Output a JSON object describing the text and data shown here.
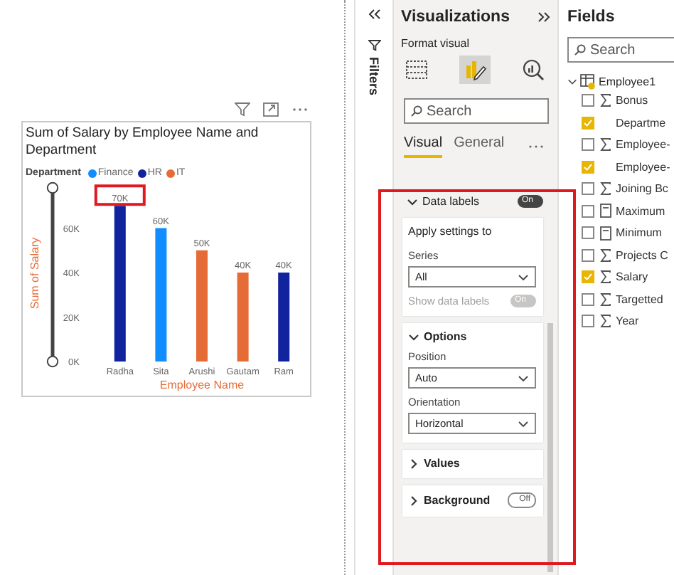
{
  "report": {
    "visual": {
      "title": "Sum of Salary by Employee Name and Department",
      "legend_title": "Department",
      "highlighted_labels": [
        true,
        false,
        false,
        false,
        false
      ],
      "chart_data": {
        "type": "bar",
        "xlabel": "Employee Name",
        "ylabel": "Sum of Salary",
        "categories": [
          "Radha",
          "Sita",
          "Arushi",
          "Gautam",
          "Ram"
        ],
        "series": [
          {
            "name": "Finance",
            "color": "#118dff",
            "values": [
              null,
              60000,
              null,
              null,
              null
            ]
          },
          {
            "name": "HR",
            "color": "#12239e",
            "values": [
              70000,
              null,
              null,
              null,
              40000
            ]
          },
          {
            "name": "IT",
            "color": "#e66c37",
            "values": [
              null,
              null,
              50000,
              40000,
              null
            ]
          }
        ],
        "ylim": [
          0,
          80000
        ],
        "yticks": [
          {
            "value": 0,
            "label": "0K"
          },
          {
            "value": 20000,
            "label": "20K"
          },
          {
            "value": 40000,
            "label": "40K"
          },
          {
            "value": 60000,
            "label": "60K"
          }
        ],
        "data_labels": "value_labels",
        "value_labels": [
          "70K",
          "60K",
          "50K",
          "40K",
          "40K"
        ]
      }
    }
  },
  "filters": {
    "label": "Filters"
  },
  "visualizations": {
    "title": "Visualizations",
    "subtitle": "Format visual",
    "view_buttons": [
      {
        "kind": "fields",
        "selected": false
      },
      {
        "kind": "format",
        "selected": true
      },
      {
        "kind": "analytics",
        "selected": false
      }
    ],
    "search": {
      "placeholder": "Search"
    },
    "tabs": [
      {
        "label": "Visual",
        "selected": true
      },
      {
        "label": "General",
        "selected": false
      }
    ],
    "sections": [
      {
        "title": "Data labels",
        "expanded": true,
        "toggle": {
          "label": "On",
          "on": true
        },
        "highlighted": true,
        "cards": [
          {
            "title": "Apply settings to",
            "fields": [
              {
                "kind": "dropdown",
                "label": "Series",
                "value": "All"
              },
              {
                "kind": "toggle",
                "label": "Show data labels",
                "disabled": true,
                "toggle": {
                  "label": "On",
                  "on": true
                }
              }
            ]
          },
          {
            "title": "Options",
            "expanded": true,
            "fields": [
              {
                "kind": "dropdown",
                "label": "Position",
                "value": "Auto"
              },
              {
                "kind": "dropdown",
                "label": "Orientation",
                "value": "Horizontal"
              }
            ]
          },
          {
            "title": "Values",
            "expanded": false
          },
          {
            "title": "Background",
            "expanded": false,
            "toggle": {
              "label": "Off",
              "on": false
            }
          }
        ]
      }
    ]
  },
  "fields": {
    "title": "Fields",
    "search": {
      "placeholder": "Search"
    },
    "tables": [
      {
        "name": "Employee1",
        "expanded": true,
        "children": [
          {
            "name": "Bonus",
            "kind": "sigma",
            "checked": false
          },
          {
            "name": "Departme",
            "kind": "text",
            "checked": true
          },
          {
            "name": "Employee-",
            "kind": "sigma",
            "checked": false
          },
          {
            "name": "Employee-",
            "kind": "text",
            "checked": true
          },
          {
            "name": "Joining Bc",
            "kind": "sigma",
            "checked": false
          },
          {
            "name": "Maximum",
            "kind": "calc",
            "checked": false
          },
          {
            "name": "Minimum",
            "kind": "calc",
            "checked": false
          },
          {
            "name": "Projects C",
            "kind": "sigma",
            "checked": false
          },
          {
            "name": "Salary",
            "kind": "sigma",
            "checked": true
          },
          {
            "name": "Targetted",
            "kind": "sigma",
            "checked": false
          },
          {
            "name": "Year",
            "kind": "sigma",
            "checked": false
          }
        ]
      }
    ]
  }
}
